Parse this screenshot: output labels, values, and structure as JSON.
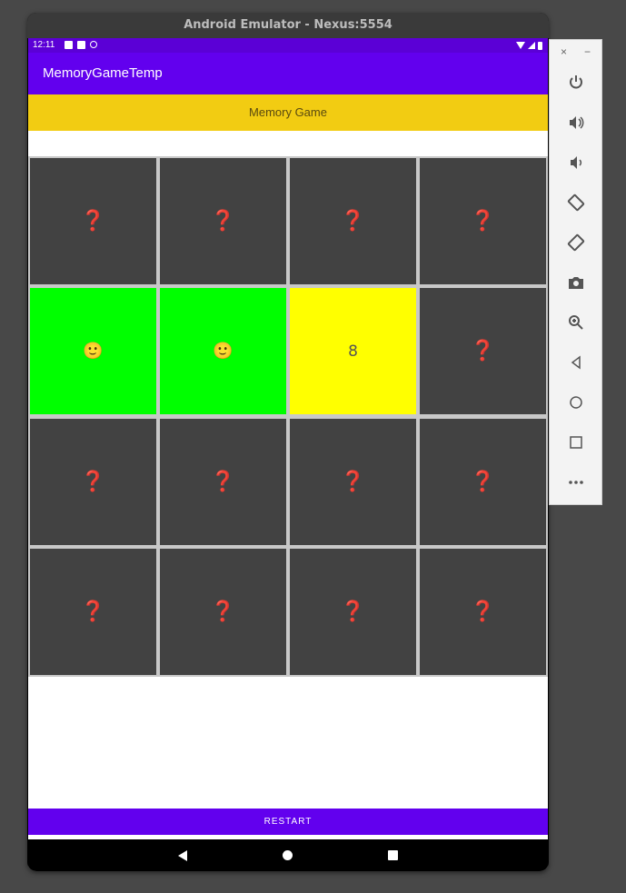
{
  "window": {
    "title": "Android Emulator - Nexus:5554"
  },
  "status_bar": {
    "time": "12:11"
  },
  "app_bar": {
    "title": "MemoryGameTemp"
  },
  "game": {
    "header": "Memory Game",
    "restart_label": "RESTART",
    "cards": [
      {
        "state": "hidden",
        "glyph": "❓"
      },
      {
        "state": "hidden",
        "glyph": "❓"
      },
      {
        "state": "hidden",
        "glyph": "❓"
      },
      {
        "state": "hidden",
        "glyph": "❓"
      },
      {
        "state": "matched",
        "glyph": "🙂"
      },
      {
        "state": "matched",
        "glyph": "🙂"
      },
      {
        "state": "flipped",
        "glyph": "8"
      },
      {
        "state": "hidden",
        "glyph": "❓"
      },
      {
        "state": "hidden",
        "glyph": "❓"
      },
      {
        "state": "hidden",
        "glyph": "❓"
      },
      {
        "state": "hidden",
        "glyph": "❓"
      },
      {
        "state": "hidden",
        "glyph": "❓"
      },
      {
        "state": "hidden",
        "glyph": "❓"
      },
      {
        "state": "hidden",
        "glyph": "❓"
      },
      {
        "state": "hidden",
        "glyph": "❓"
      },
      {
        "state": "hidden",
        "glyph": "❓"
      }
    ]
  },
  "colors": {
    "app_bar": "#6200ee",
    "status_bar": "#5b00d6",
    "header": "#f2cc12",
    "card_hidden": "#424242",
    "card_matched": "#00ff00",
    "card_flipped": "#ffff00"
  },
  "side_toolbar": {
    "close": "×",
    "minimize": "−",
    "buttons": [
      "power-icon",
      "volume-up-icon",
      "volume-down-icon",
      "rotate-left-icon",
      "rotate-right-icon",
      "camera-icon",
      "zoom-icon",
      "back-icon",
      "home-icon",
      "overview-icon",
      "more-icon"
    ]
  }
}
